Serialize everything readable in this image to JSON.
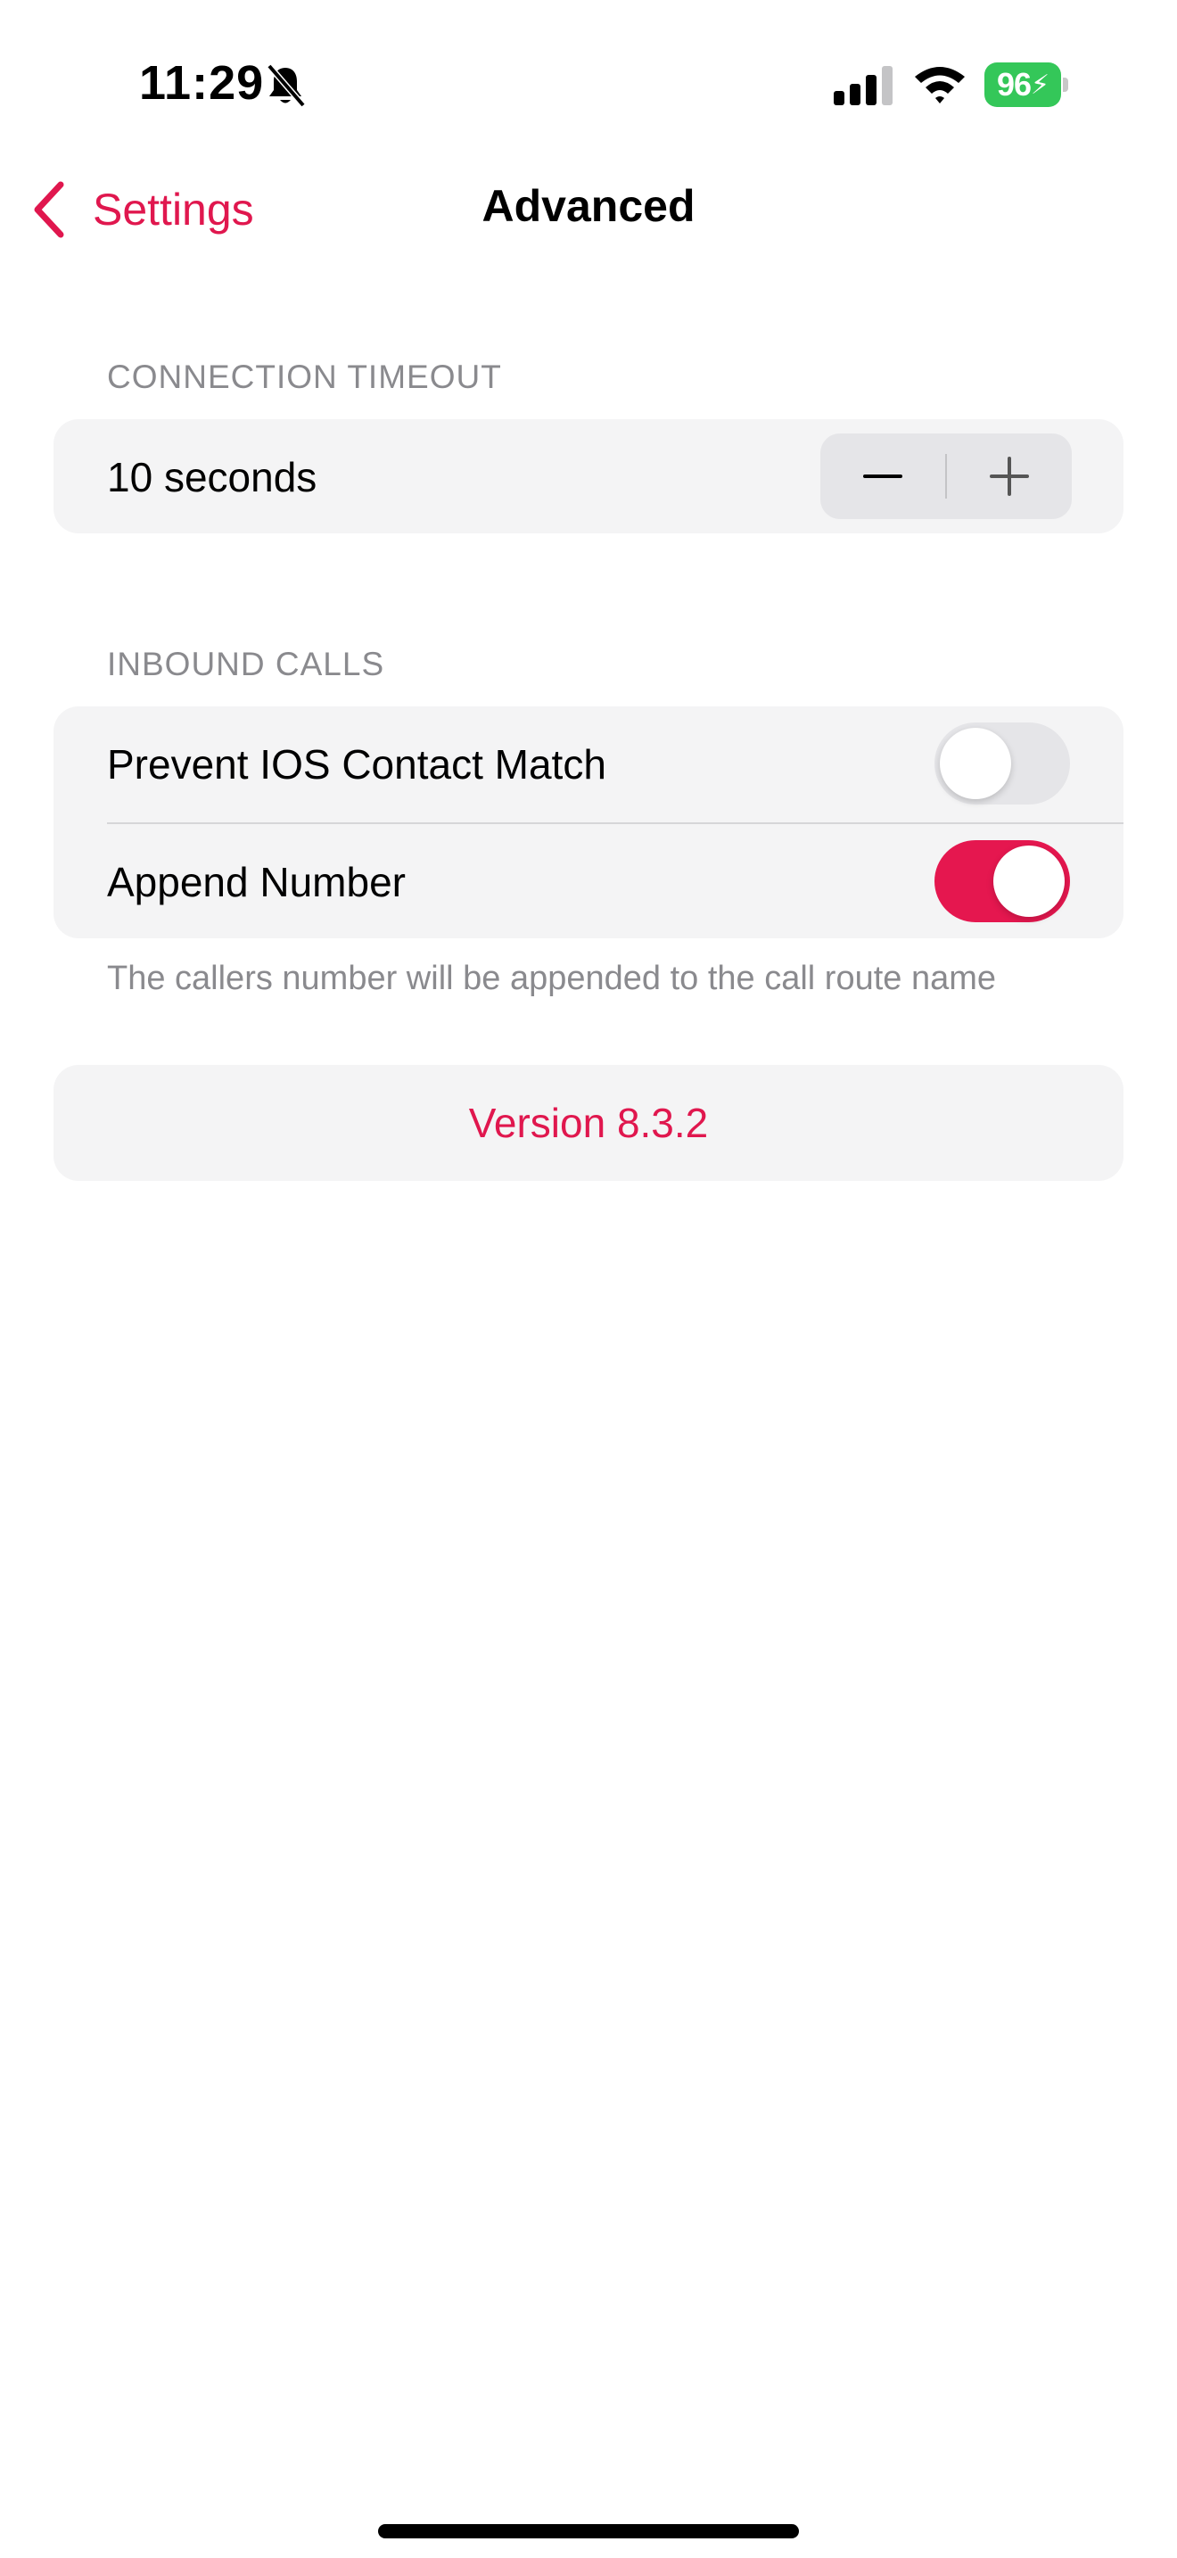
{
  "status_bar": {
    "time": "11:29",
    "battery_level": "96",
    "icons": [
      "bell-slash-icon",
      "cellular-signal-icon",
      "wifi-icon",
      "battery-charging-icon"
    ]
  },
  "nav": {
    "back_label": "Settings",
    "title": "Advanced"
  },
  "connection_timeout": {
    "header": "CONNECTION TIMEOUT",
    "value_label": "10 seconds",
    "decrement_icon": "minus-icon",
    "increment_icon": "plus-icon"
  },
  "inbound_calls": {
    "header": "INBOUND CALLS",
    "rows": [
      {
        "label": "Prevent IOS Contact Match",
        "enabled": false
      },
      {
        "label": "Append Number",
        "enabled": true
      }
    ],
    "footer": "The callers number will be appended to the call route name"
  },
  "version": {
    "label": "Version 8.3.2"
  },
  "colors": {
    "accent": "#e0174e",
    "toggle_on": "#e5174f",
    "battery": "#34c759",
    "card_bg": "#f4f4f5",
    "secondary_text": "#8a8a8e"
  }
}
